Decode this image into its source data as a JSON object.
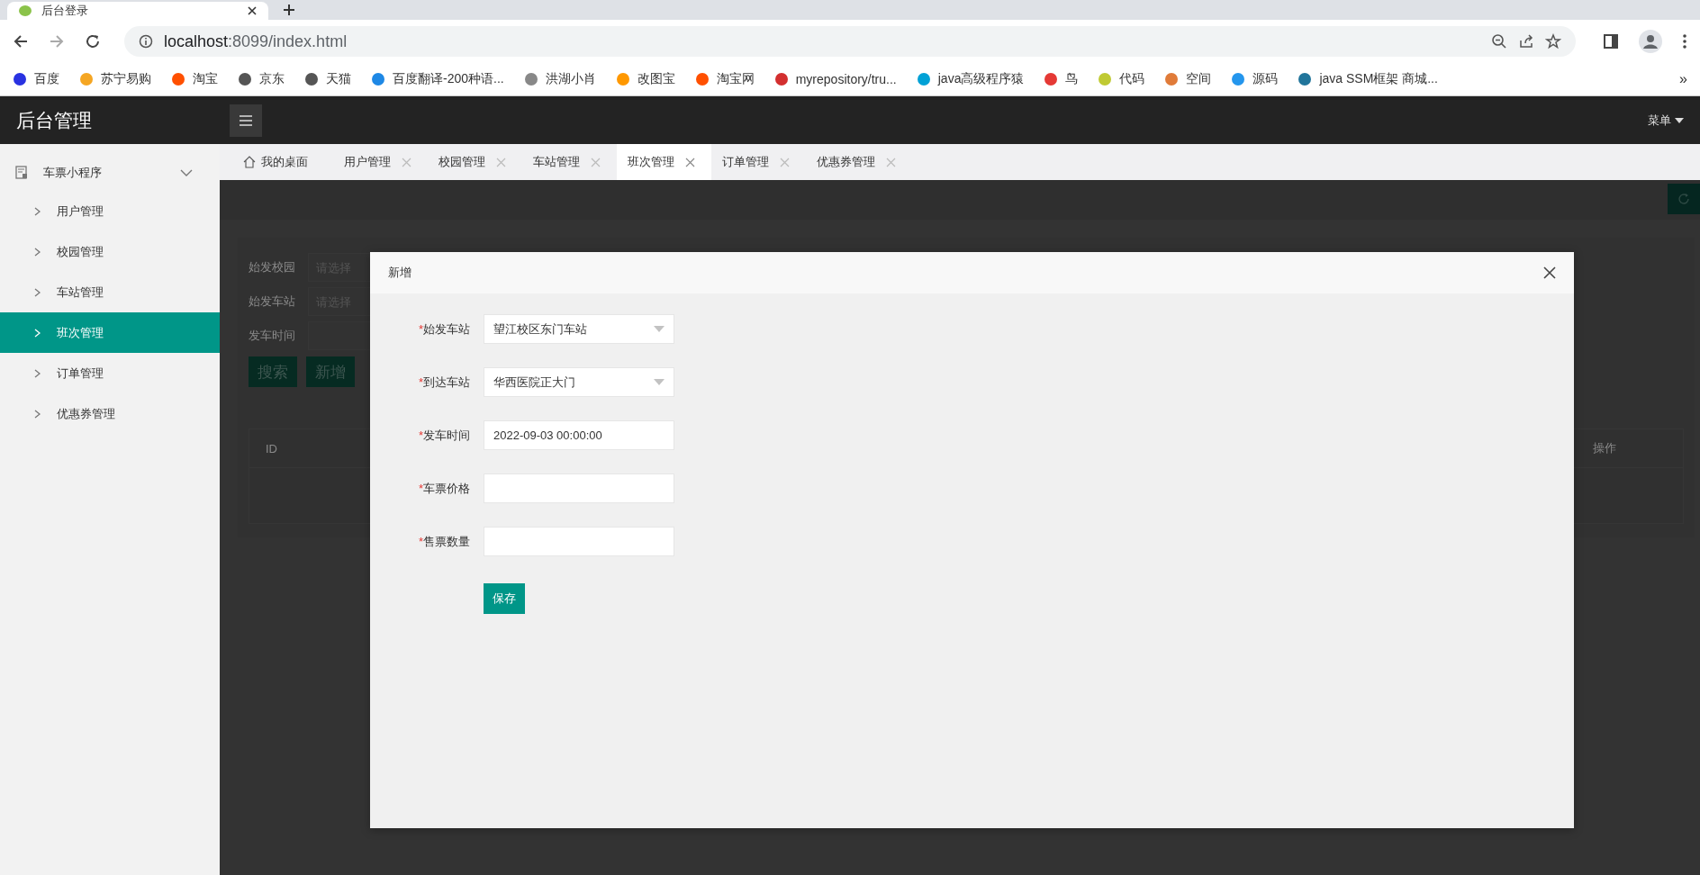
{
  "browser": {
    "tab_title": "后台登录",
    "url_host": "localhost",
    "url_rest": ":8099/index.html",
    "bookmarks": [
      {
        "label": "百度",
        "color": "#2932e1"
      },
      {
        "label": "苏宁易购",
        "color": "#f5a623"
      },
      {
        "label": "淘宝",
        "color": "#ff5000"
      },
      {
        "label": "京东",
        "color": "#555555"
      },
      {
        "label": "天猫",
        "color": "#555555"
      },
      {
        "label": "百度翻译-200种语...",
        "color": "#1e88e5"
      },
      {
        "label": "洪湖小肖",
        "color": "#888888"
      },
      {
        "label": "改图宝",
        "color": "#ff9800"
      },
      {
        "label": "淘宝网",
        "color": "#ff5000"
      },
      {
        "label": "myrepository/tru...",
        "color": "#d32f2f"
      },
      {
        "label": "java高级程序猿",
        "color": "#00a1d6"
      },
      {
        "label": "鸟",
        "color": "#e53935"
      },
      {
        "label": "代码",
        "color": "#c0ca33"
      },
      {
        "label": "空间",
        "color": "#e07b39"
      },
      {
        "label": "源码",
        "color": "#2496ed"
      },
      {
        "label": "java SSM框架 商城...",
        "color": "#21759b"
      }
    ],
    "more": "»"
  },
  "app": {
    "title": "后台管理",
    "menu_label": "菜单"
  },
  "sidebar": {
    "group": {
      "label": "车票小程序",
      "expanded": true,
      "items": [
        {
          "label": "用户管理",
          "selected": false
        },
        {
          "label": "校园管理",
          "selected": false
        },
        {
          "label": "车站管理",
          "selected": false
        },
        {
          "label": "班次管理",
          "selected": true
        },
        {
          "label": "订单管理",
          "selected": false
        },
        {
          "label": "优惠券管理",
          "selected": false
        }
      ]
    }
  },
  "tabs": [
    {
      "label": "我的桌面",
      "kind": "home",
      "selected": false
    },
    {
      "label": "用户管理",
      "kind": "page",
      "selected": false
    },
    {
      "label": "校园管理",
      "kind": "page",
      "selected": false
    },
    {
      "label": "车站管理",
      "kind": "page",
      "selected": false
    },
    {
      "label": "班次管理",
      "kind": "page",
      "selected": true
    },
    {
      "label": "订单管理",
      "kind": "page",
      "selected": false
    },
    {
      "label": "优惠券管理",
      "kind": "page",
      "selected": false
    }
  ],
  "search_form": {
    "fields": [
      {
        "label": "始发校园",
        "placeholder": "请选择"
      },
      {
        "label": "始发车站",
        "placeholder": "请选择"
      },
      {
        "label": "发车时间"
      }
    ],
    "buttons": [
      "搜索",
      "新增"
    ]
  },
  "table": {
    "columns": [
      "ID",
      "操作"
    ]
  },
  "dialog": {
    "title": "新增",
    "fields": [
      {
        "label": "始发车站",
        "required_mark": "*",
        "kind": "select",
        "value": "望江校区东门车站"
      },
      {
        "label": "到达车站",
        "required_mark": "*",
        "kind": "select",
        "value": "华西医院正大门"
      },
      {
        "label": "发车时间",
        "required_mark": "*",
        "kind": "text",
        "value": "2022-09-03 00:00:00"
      },
      {
        "label": "车票价格",
        "required_mark": "*",
        "kind": "text"
      },
      {
        "label": "售票数量",
        "required_mark": "*",
        "kind": "text"
      }
    ],
    "save_button": "保存"
  }
}
